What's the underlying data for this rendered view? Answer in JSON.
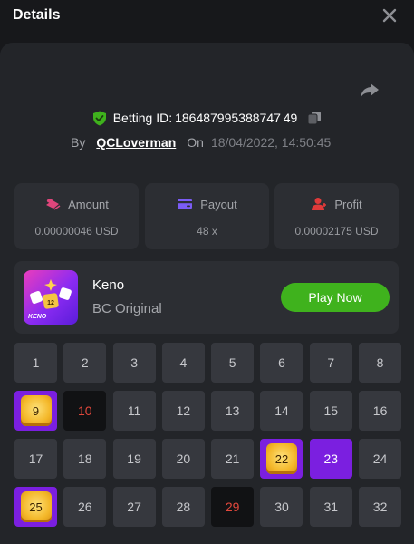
{
  "header": {
    "title": "Details"
  },
  "bet": {
    "betting_id_label": "Betting ID:",
    "betting_id": "186487995388747 49",
    "by_label": "By",
    "user": "QCLoverman",
    "on_label": "On",
    "datetime": "18/04/2022, 14:50:45"
  },
  "stats": [
    {
      "label": "Amount",
      "value": "0.00000046 USD",
      "icon": "coins-icon",
      "color": "#e0457b"
    },
    {
      "label": "Payout",
      "value": "48 x",
      "icon": "wallet-icon",
      "color": "#7b5cf5"
    },
    {
      "label": "Profit",
      "value": "0.00002175 USD",
      "icon": "user-profit-icon",
      "color": "#e03a3a"
    }
  ],
  "game": {
    "name": "Keno",
    "subtitle": "BC Original",
    "thumb_label": "KENO",
    "play_label": "Play Now"
  },
  "grid": {
    "cells": [
      {
        "n": "1",
        "s": "normal"
      },
      {
        "n": "2",
        "s": "normal"
      },
      {
        "n": "3",
        "s": "normal"
      },
      {
        "n": "4",
        "s": "normal"
      },
      {
        "n": "5",
        "s": "normal"
      },
      {
        "n": "6",
        "s": "normal"
      },
      {
        "n": "7",
        "s": "normal"
      },
      {
        "n": "8",
        "s": "normal"
      },
      {
        "n": "9",
        "s": "hit"
      },
      {
        "n": "10",
        "s": "miss"
      },
      {
        "n": "11",
        "s": "normal"
      },
      {
        "n": "12",
        "s": "normal"
      },
      {
        "n": "13",
        "s": "normal"
      },
      {
        "n": "14",
        "s": "normal"
      },
      {
        "n": "15",
        "s": "normal"
      },
      {
        "n": "16",
        "s": "normal"
      },
      {
        "n": "17",
        "s": "normal"
      },
      {
        "n": "18",
        "s": "normal"
      },
      {
        "n": "19",
        "s": "normal"
      },
      {
        "n": "20",
        "s": "normal"
      },
      {
        "n": "21",
        "s": "normal"
      },
      {
        "n": "22",
        "s": "hit"
      },
      {
        "n": "23",
        "s": "pick"
      },
      {
        "n": "24",
        "s": "normal"
      },
      {
        "n": "25",
        "s": "hit"
      },
      {
        "n": "26",
        "s": "normal"
      },
      {
        "n": "27",
        "s": "normal"
      },
      {
        "n": "28",
        "s": "normal"
      },
      {
        "n": "29",
        "s": "miss"
      },
      {
        "n": "30",
        "s": "normal"
      },
      {
        "n": "31",
        "s": "normal"
      },
      {
        "n": "32",
        "s": "normal"
      }
    ]
  }
}
